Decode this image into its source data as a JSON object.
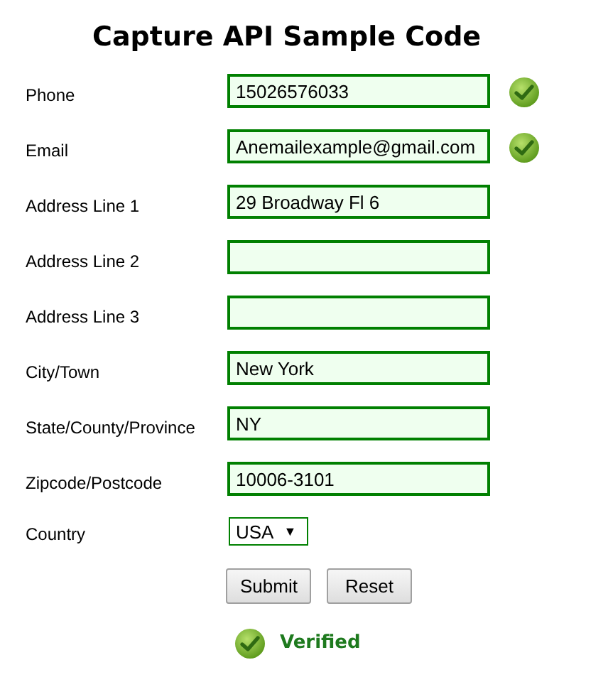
{
  "title": "Capture API Sample Code",
  "fields": [
    {
      "label": "Phone",
      "value": "15026576033",
      "validated": true
    },
    {
      "label": "Email",
      "value": "Anemailexample@gmail.com",
      "validated": true
    },
    {
      "label": "Address Line 1",
      "value": "29 Broadway Fl 6",
      "validated": false
    },
    {
      "label": "Address Line 2",
      "validated": false
    },
    {
      "label": "Address Line 3",
      "validated": false
    },
    {
      "label": "City/Town",
      "value": "New York",
      "validated": false
    },
    {
      "label": "State/County/Province",
      "value": "NY",
      "validated": false
    },
    {
      "label": "Zipcode/Postcode",
      "value": "10006-3101",
      "validated": false
    }
  ],
  "country": {
    "label": "Country",
    "value": "USA",
    "arrow": "▼"
  },
  "buttons": [
    "Submit",
    "Reset"
  ],
  "status": {
    "text": "Verified",
    "verified": true
  }
}
